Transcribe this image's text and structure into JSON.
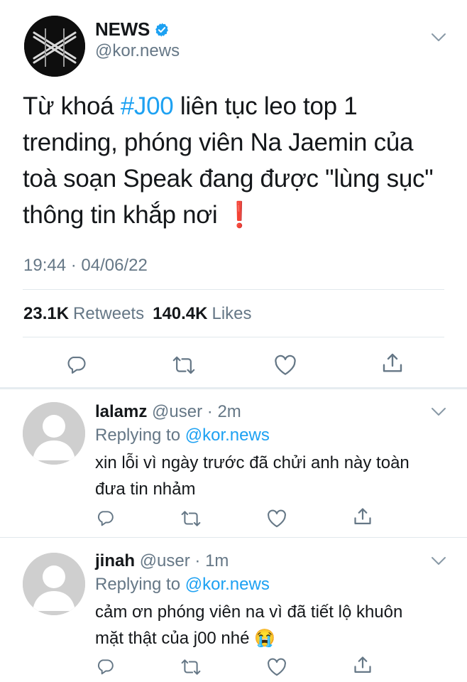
{
  "main_tweet": {
    "author_name": "NEWS",
    "handle": "@kor.news",
    "text_lines": [
      {
        "before": "Từ khoá ",
        "hashtag": "#J00",
        "after": " liên tục leo top 1"
      },
      {
        "text": "trending, phóng viên Na Jaemin của"
      },
      {
        "text": "toà soạn Speak đang được \"lùng sục\""
      },
      {
        "text": "thông tin khắp nơi",
        "emoji": "❗"
      }
    ],
    "timestamp": "19:44 · 04/06/22",
    "retweets_count": "23.1K",
    "retweets_label": "Retweets",
    "likes_count": "140.4K",
    "likes_label": "Likes"
  },
  "replies": [
    {
      "name": "lalamz",
      "handle": "@user",
      "time": "· 2m",
      "replying_prefix": "Replying to ",
      "replying_to": "@kor.news",
      "text_lines": [
        "xin lỗi vì ngày trước đã chửi anh này toàn",
        "đưa tin nhảm"
      ]
    },
    {
      "name": "jinah",
      "handle": "@user",
      "time": "· 1m",
      "replying_prefix": "Replying to ",
      "replying_to": "@kor.news",
      "text_lines": [
        "cảm ơn phóng viên na vì đã tiết lộ khuôn",
        "mặt thật của j00 nhé"
      ],
      "emoji": "😭"
    }
  ],
  "icons": [
    "reply-icon",
    "retweet-icon",
    "like-icon",
    "share-icon",
    "chevron-down-icon",
    "verified-badge-icon"
  ],
  "colors": {
    "accent": "#1da1f2",
    "muted": "#657786",
    "text": "#14171a",
    "divider": "#e1e8ed"
  }
}
